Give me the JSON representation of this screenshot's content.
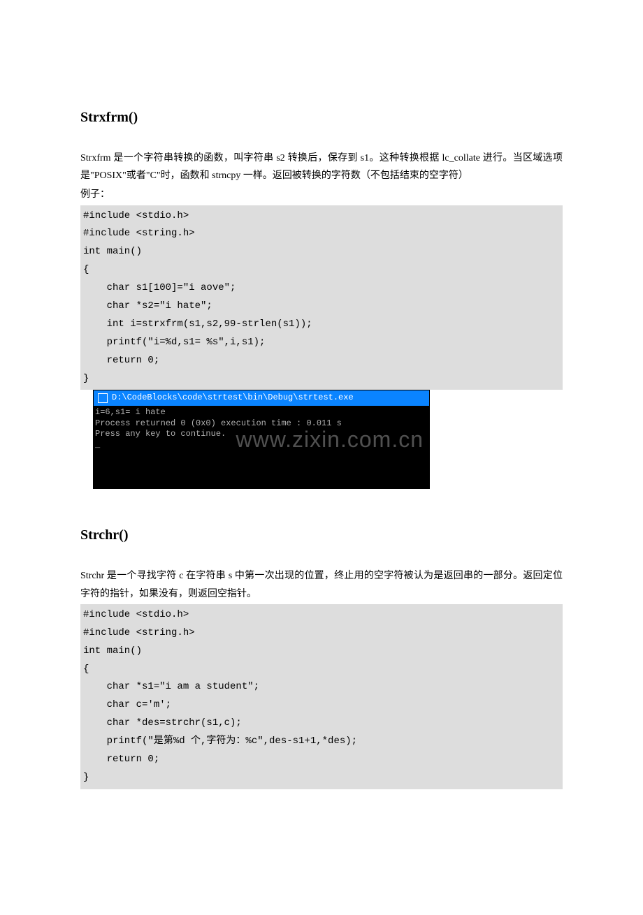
{
  "section1": {
    "heading": "Strxfrm()",
    "desc1": "Strxfrm 是一个字符串转换的函数，叫字符串 s2 转换后，保存到 s1。这种转换根据 lc_collate 进行。当区域选项是\"POSIX\"或者\"C\"时，函数和 strncpy 一样。返回被转换的字符数（不包括结束的空字符）",
    "desc2": "例子：",
    "code": "#include <stdio.h>\n#include <string.h>\nint main()\n{\n    char s1[100]=\"i aove\";\n    char *s2=\"i hate\";\n    int i=strxfrm(s1,s2,99-strlen(s1));\n    printf(\"i=%d,s1= %s\",i,s1);\n    return 0;\n}",
    "terminal": {
      "title": "D:\\CodeBlocks\\code\\strtest\\bin\\Debug\\strtest.exe",
      "line1": "i=6,s1= i hate",
      "line2": "Process returned 0 (0x0)   execution time : 0.011 s",
      "line3": "Press any key to continue.",
      "cursor": "_",
      "watermark": "www.zixin.com.cn"
    }
  },
  "section2": {
    "heading": "Strchr()",
    "desc1": "Strchr 是一个寻找字符 c 在字符串 s 中第一次出现的位置，终止用的空字符被认为是返回串的一部分。返回定位字符的指针，如果没有，则返回空指针。",
    "code": "#include <stdio.h>\n#include <string.h>\nint main()\n{\n    char *s1=\"i am a student\";\n    char c='m';\n    char *des=strchr(s1,c);\n    printf(\"是第%d 个,字符为：%c\",des-s1+1,*des);\n    return 0;\n}"
  }
}
